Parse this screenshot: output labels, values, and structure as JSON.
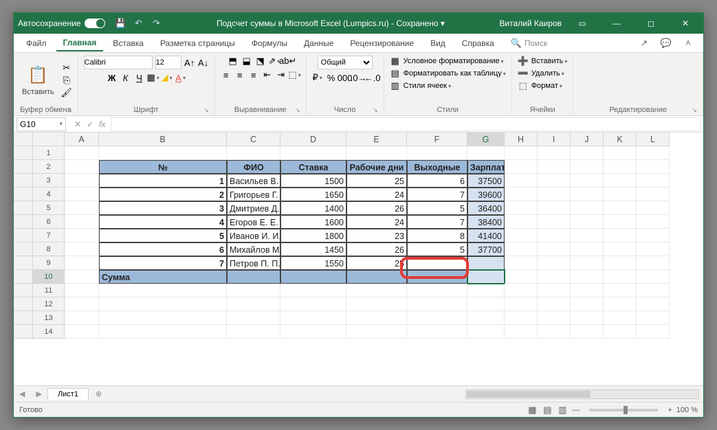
{
  "titlebar": {
    "autosave": "Автосохранение",
    "doc_title": "Подсчет суммы в Microsoft Excel (Lumpics.ru)",
    "saved": "Сохранено",
    "user": "Виталий Каиров"
  },
  "tabs": {
    "file": "Файл",
    "home": "Главная",
    "insert": "Вставка",
    "layout": "Разметка страницы",
    "formulas": "Формулы",
    "data": "Данные",
    "review": "Рецензирование",
    "view": "Вид",
    "help": "Справка",
    "search": "Поиск"
  },
  "ribbon": {
    "paste": "Вставить",
    "clipboard": "Буфер обмена",
    "font_name": "Calibri",
    "font_size": "12",
    "font": "Шрифт",
    "alignment": "Выравнивание",
    "number_format": "Общий",
    "number": "Число",
    "cond_fmt": "Условное форматирование",
    "as_table": "Форматировать как таблицу",
    "cell_styles": "Стили ячеек",
    "styles": "Стили",
    "insert_cells": "Вставить",
    "delete_cells": "Удалить",
    "format_cells": "Формат",
    "cells": "Ячейки",
    "editing": "Редактирование"
  },
  "namebox": "G10",
  "columns": [
    "A",
    "B",
    "C",
    "D",
    "E",
    "F",
    "G",
    "H",
    "I",
    "J",
    "K",
    "L"
  ],
  "table": {
    "headers": [
      "№",
      "ФИО",
      "Ставка",
      "Рабочие дни",
      "Выходные",
      "Зарплата"
    ],
    "rows": [
      {
        "n": "1",
        "fio": "Васильев В. В.",
        "rate": "1500",
        "wd": "25",
        "we": "6",
        "sal": "37500"
      },
      {
        "n": "2",
        "fio": "Григорьев Г. Г.",
        "rate": "1650",
        "wd": "24",
        "we": "7",
        "sal": "39600"
      },
      {
        "n": "3",
        "fio": "Дмитриев Д. Д.",
        "rate": "1400",
        "wd": "26",
        "we": "5",
        "sal": "36400"
      },
      {
        "n": "4",
        "fio": "Егоров Е. Е.",
        "rate": "1600",
        "wd": "24",
        "we": "7",
        "sal": "38400"
      },
      {
        "n": "5",
        "fio": "Иванов И. И.",
        "rate": "1800",
        "wd": "23",
        "we": "8",
        "sal": "41400"
      },
      {
        "n": "6",
        "fio": "Михайлов М. М.",
        "rate": "1450",
        "wd": "26",
        "we": "5",
        "sal": "37700"
      },
      {
        "n": "7",
        "fio": "Петров П. П.",
        "rate": "1550",
        "wd": "25",
        "we": "",
        "sal": ""
      }
    ],
    "sum_label": "Сумма"
  },
  "sheet_tab": "Лист1",
  "status": "Готово",
  "zoom": "100 %"
}
